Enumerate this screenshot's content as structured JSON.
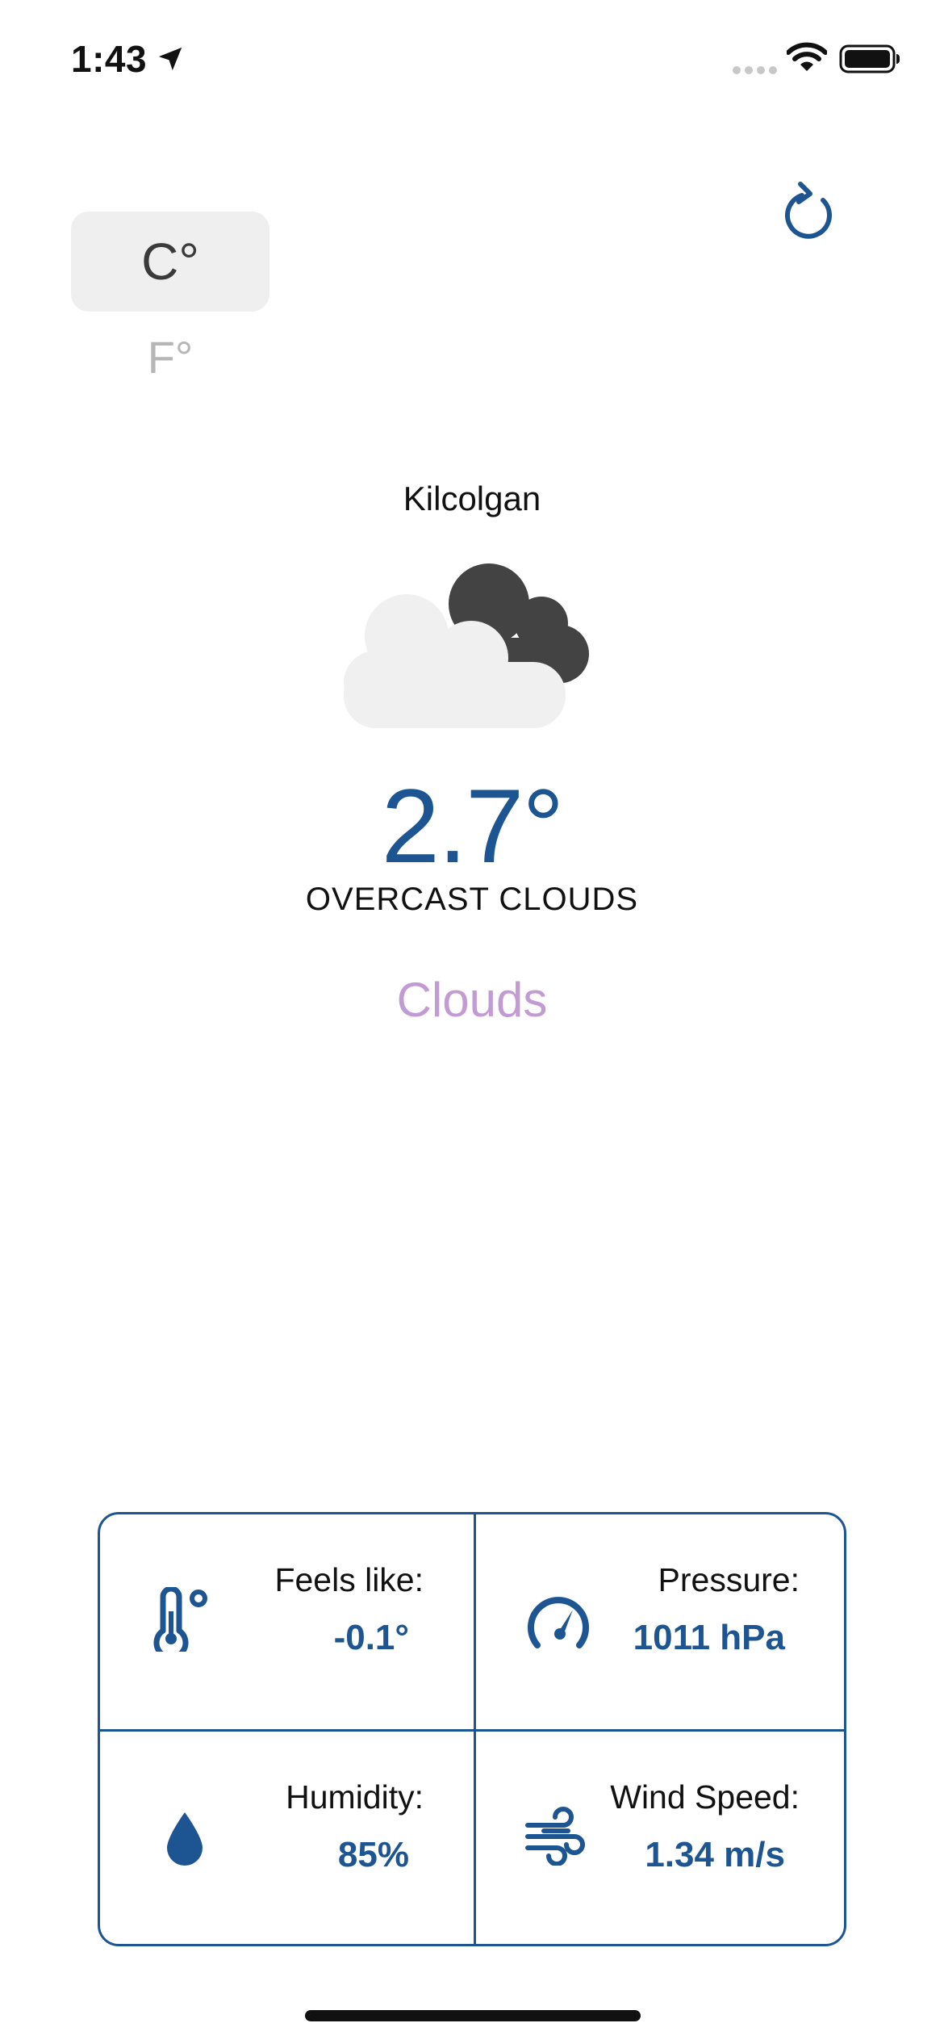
{
  "status_bar": {
    "time": "1:43"
  },
  "units": {
    "celsius_label": "C°",
    "fahrenheit_label": "F°",
    "selected": "celsius"
  },
  "weather": {
    "city": "Kilcolgan",
    "temperature": "2.7°",
    "description": "OVERCAST CLOUDS",
    "main": "Clouds"
  },
  "details": {
    "feels_like": {
      "label": "Feels like:",
      "value": "-0.1°",
      "icon": "thermometer-icon"
    },
    "pressure": {
      "label": "Pressure:",
      "value": "1011 hPa",
      "icon": "gauge-icon"
    },
    "humidity": {
      "label": "Humidity:",
      "value": "85%",
      "icon": "droplet-icon"
    },
    "wind_speed": {
      "label": "Wind Speed:",
      "value": "1.34 m/s",
      "icon": "wind-icon"
    }
  },
  "colors": {
    "accent": "#1d5592",
    "main_condition": "#c29bd4",
    "toggle_bg": "#efefef"
  }
}
